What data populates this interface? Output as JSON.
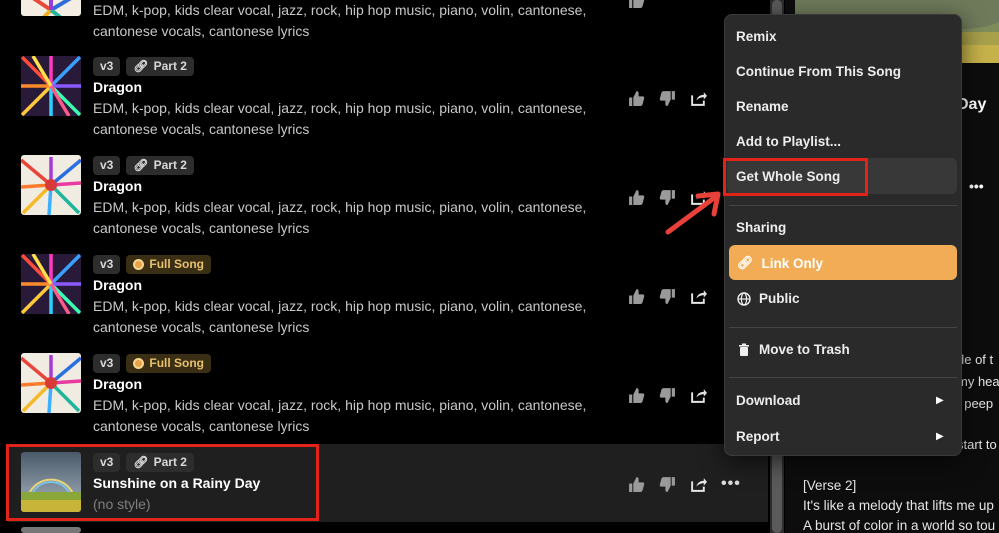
{
  "songs": [
    {
      "version": "",
      "badge": "",
      "badge_type": "",
      "title": "",
      "style_line1": "EDM, k-pop, kids clear vocal, jazz, rock, hip hop music, piano, volin, cantonese,",
      "style_line2": "cantonese vocals, cantonese lyrics"
    },
    {
      "version": "v3",
      "badge": "Part 2",
      "badge_type": "part",
      "title": "Dragon",
      "style_line1": "EDM, k-pop, kids clear vocal, jazz, rock, hip hop music, piano, volin, cantonese,",
      "style_line2": "cantonese vocals, cantonese lyrics"
    },
    {
      "version": "v3",
      "badge": "Part 2",
      "badge_type": "part",
      "title": "Dragon",
      "style_line1": "EDM, k-pop, kids clear vocal, jazz, rock, hip hop music, piano, volin, cantonese,",
      "style_line2": "cantonese vocals, cantonese lyrics"
    },
    {
      "version": "v3",
      "badge": "Full Song",
      "badge_type": "full",
      "title": "Dragon",
      "style_line1": "EDM, k-pop, kids clear vocal, jazz, rock, hip hop music, piano, volin, cantonese,",
      "style_line2": "cantonese vocals, cantonese lyrics"
    },
    {
      "version": "v3",
      "badge": "Full Song",
      "badge_type": "full",
      "title": "Dragon",
      "style_line1": "EDM, k-pop, kids clear vocal, jazz, rock, hip hop music, piano, volin, cantonese,",
      "style_line2": "cantonese vocals, cantonese lyrics"
    },
    {
      "version": "v3",
      "badge": "Part 2",
      "badge_type": "part",
      "title": "Sunshine on a Rainy Day",
      "style_line1": "(no style)",
      "style_line2": ""
    }
  ],
  "actions": {
    "more_label": "•••"
  },
  "context_menu": {
    "items": [
      {
        "label": "Remix"
      },
      {
        "label": "Continue From This Song"
      },
      {
        "label": "Rename"
      },
      {
        "label": "Add to Playlist..."
      },
      {
        "label": "Get Whole Song"
      }
    ],
    "sharing_header": "Sharing",
    "sharing_options": [
      {
        "label": "Link Only",
        "icon": "link-icon",
        "selected": true
      },
      {
        "label": "Public",
        "icon": "globe-icon",
        "selected": false
      }
    ],
    "trash_label": "Move to Trash",
    "download_label": "Download",
    "report_label": "Report",
    "submenu_arrow": "▶"
  },
  "detail_panel": {
    "title_fragment": "Day",
    "more_label": "•••",
    "lyric_fragments": [
      "de of t",
      "my hea",
      "t peep",
      "start to"
    ],
    "verse_label": "[Verse 2]",
    "verse_lines": [
      "It's like a melody that lifts me up",
      "A burst of color in a world so tou"
    ]
  },
  "colors": {
    "accent": "#f1ac55",
    "highlight": "#e2231a",
    "full_song_badge": "#e8c170"
  }
}
